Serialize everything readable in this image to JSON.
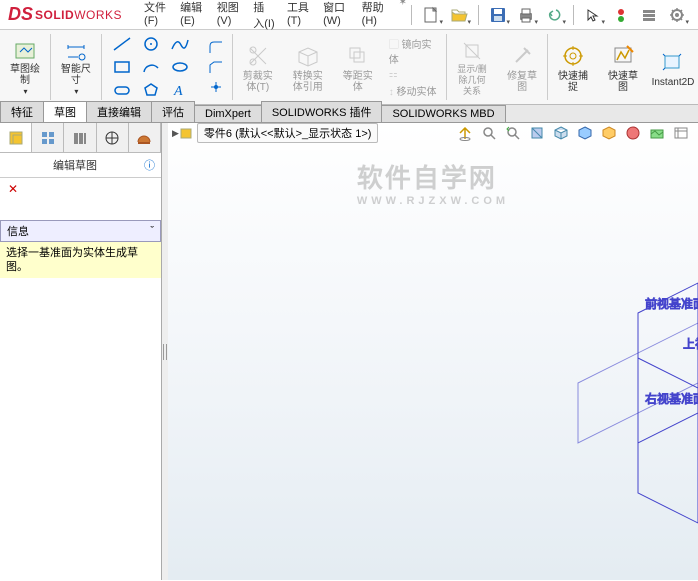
{
  "app": {
    "brand_prefix": "SOLID",
    "brand_suffix": "WORKS"
  },
  "menu": {
    "file": "文件(F)",
    "edit": "编辑(E)",
    "view": "视图(V)",
    "insert": "插入(I)",
    "tools": "工具(T)",
    "window": "窗口(W)",
    "help": "帮助(H)"
  },
  "ribbon": {
    "sketch_draw": "草图绘\n制",
    "smart_dim": "智能尺\n寸",
    "trim_entity": "剪裁实\n体(T)",
    "convert_entity": "转换实\n体引用",
    "offset_entity": "等距实\n体",
    "mirror": "镜向实\n体",
    "move_entity": "移动实体",
    "show_hide": "显示/删\n除几何\n关系",
    "repair": "修复草\n图",
    "rapid_sketch": "快速捕\n捉",
    "rapid_sketch2": "快速草\n图",
    "instant2d": "Instant2D"
  },
  "tabs": {
    "feature": "特征",
    "sketch": "草图",
    "direct_edit": "直接编辑",
    "evaluate": "评估",
    "dimxpert": "DimXpert",
    "sw_addins": "SOLIDWORKS 插件",
    "sw_mbd": "SOLIDWORKS MBD"
  },
  "side": {
    "title": "编辑草图",
    "info_header": "信息",
    "info_body": "选择一基准面为实体生成草图。"
  },
  "breadcrumb": {
    "part": "零件6 (默认<<默认>_显示状态 1>)"
  },
  "planes": {
    "front": "前视基准面",
    "top": "上视",
    "right": "右视基准面"
  },
  "watermark": {
    "main": "软件自学网",
    "sub": "WWW.RJZXW.COM"
  }
}
